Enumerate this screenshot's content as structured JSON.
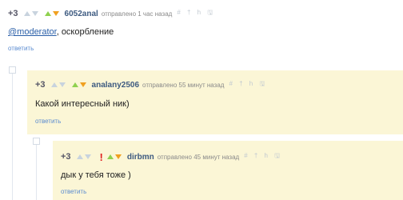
{
  "comments": [
    {
      "score": "+3",
      "user": "6052anal",
      "time": "отправлено 1 час назад",
      "tools": "# † h 🖫",
      "mention": "@moderator",
      "text": ", оскорбление",
      "reply": "ответить"
    },
    {
      "score": "+3",
      "user": "analany2506",
      "time": "отправлено 55 минут назад",
      "tools": "# † h 🖫",
      "text": "Какой интересный ник)",
      "reply": "ответить"
    },
    {
      "score": "+3",
      "flag": "!",
      "user": "dirbmn",
      "time": "отправлено 45 минут назад",
      "tools": "# † h 🖫",
      "text": "дык у тебя тоже )",
      "reply": "ответить"
    }
  ],
  "colors": {
    "highlight_bg": "#fbf6d6",
    "username": "#3d5a80",
    "link": "#5a8bd0",
    "upvote": "#8fd14f",
    "downvote": "#f0a020",
    "flag": "#e02020"
  },
  "icons": [
    "vote-up-icon",
    "vote-down-icon",
    "thread-collapse-icon",
    "save-icon",
    "alert-icon"
  ]
}
